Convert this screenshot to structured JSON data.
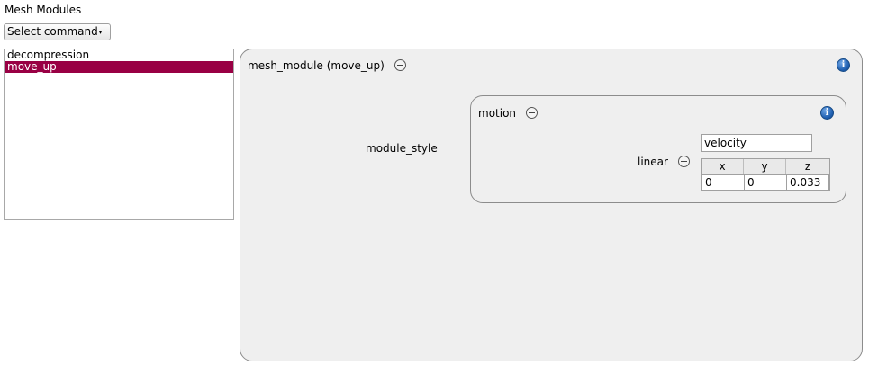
{
  "header": {
    "title": "Mesh Modules"
  },
  "command": {
    "label": "Select command",
    "arrow": "▾"
  },
  "module_list": {
    "items": [
      {
        "label": "decompression",
        "selected": false
      },
      {
        "label": "move_up",
        "selected": true
      }
    ]
  },
  "mesh_module": {
    "title": "mesh_module (move_up)",
    "module_style_label": "module_style",
    "motion": {
      "title": "motion",
      "linear_label": "linear",
      "type_value": "velocity",
      "columns": [
        "x",
        "y",
        "z"
      ],
      "values": [
        "0",
        "0",
        "0.033"
      ]
    }
  },
  "icons": {
    "info_glyph": "i"
  },
  "colors": {
    "selection": "#990044",
    "info": "#1f5fb0",
    "panel": "#efefef"
  }
}
